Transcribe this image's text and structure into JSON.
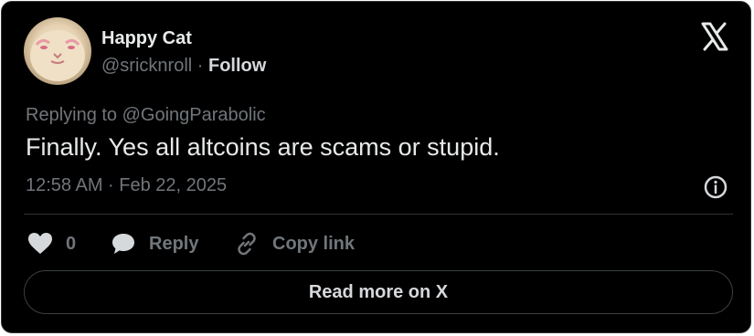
{
  "author": {
    "name": "Happy Cat",
    "handle": "@sricknroll",
    "separator": " · ",
    "follow_label": "Follow"
  },
  "logo_icon": "x-logo-icon",
  "tweet": {
    "replying_to": "Replying to @GoingParabolic",
    "text": "Finally. Yes all altcoins are scams or stupid.",
    "timestamp": "12:58 AM · Feb 22, 2025"
  },
  "actions": {
    "likes_count": "0",
    "reply_label": "Reply",
    "copy_link_label": "Copy link"
  },
  "read_more_label": "Read more on X",
  "colors": {
    "background": "#000000",
    "border": "#2f3336",
    "primary_text": "#e7e9ea",
    "secondary_text": "#71767b"
  }
}
